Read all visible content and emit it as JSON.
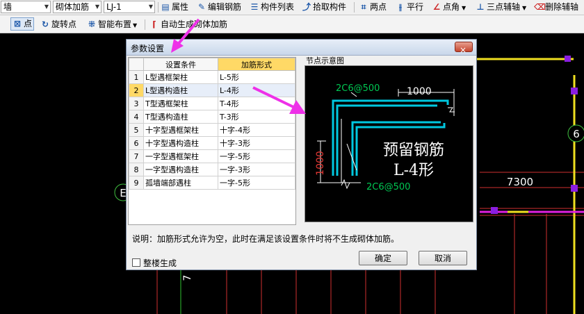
{
  "toolbar1": {
    "entity_select": "墙",
    "rebar_select": "砌体加筋",
    "item_select": "LJ-1",
    "properties": "属性",
    "edit_rebar": "编辑钢筋",
    "component_list": "构件列表",
    "pick_component": "拾取构件",
    "two_points": "两点",
    "parallel": "平行",
    "point_angle": "点角",
    "three_point_axis": "三点辅轴",
    "delete_axis": "删除辅轴"
  },
  "toolbar2": {
    "point": "点",
    "rotate_point": "旋转点",
    "smart_layout": "智能布置",
    "auto_generate": "自动生成砌体加筋"
  },
  "cad": {
    "dimension_7300": "7300",
    "axis_6": "6",
    "axis_e": "E",
    "vertical_7": "7"
  },
  "dialog": {
    "title": "参数设置",
    "close": "×",
    "columns": [
      "设置条件",
      "加筋形式"
    ],
    "rows": [
      {
        "num": "1",
        "condition": "L型遇框架柱",
        "form": "L-5形"
      },
      {
        "num": "2",
        "condition": "L型遇构造柱",
        "form": "L-4形"
      },
      {
        "num": "3",
        "condition": "T型遇框架柱",
        "form": "T-4形"
      },
      {
        "num": "4",
        "condition": "T型遇构造柱",
        "form": "T-3形"
      },
      {
        "num": "5",
        "condition": "十字型遇框架柱",
        "form": "十字-4形"
      },
      {
        "num": "6",
        "condition": "十字型遇构造柱",
        "form": "十字-3形"
      },
      {
        "num": "7",
        "condition": "一字型遇框架柱",
        "form": "一字-5形"
      },
      {
        "num": "8",
        "condition": "一字型遇构造柱",
        "form": "一字-3形"
      },
      {
        "num": "9",
        "condition": "孤墙端部遇柱",
        "form": "一字-5形"
      }
    ],
    "preview_label": "节点示意图",
    "preview": {
      "rebar_top": "2C6@500",
      "rebar_bottom": "2C6@500",
      "dim_horizontal": "1000",
      "dim_vertical": "1000",
      "caption_line1": "预留钢筋",
      "caption_line2": "L-4形"
    },
    "note": "说明：加筋形式允许为空，此时在满足该设置条件时将不生成砌体加筋。",
    "whole_building": "整楼生成",
    "ok": "确定",
    "cancel": "取消"
  },
  "colors": {
    "cad_background": "#000000",
    "rebar": "#00c8e0",
    "rebar_label": "#00c853",
    "dimension": "#ffffff",
    "vertical_dim": "#e53935",
    "annotation_arrow": "#ee30e8"
  }
}
